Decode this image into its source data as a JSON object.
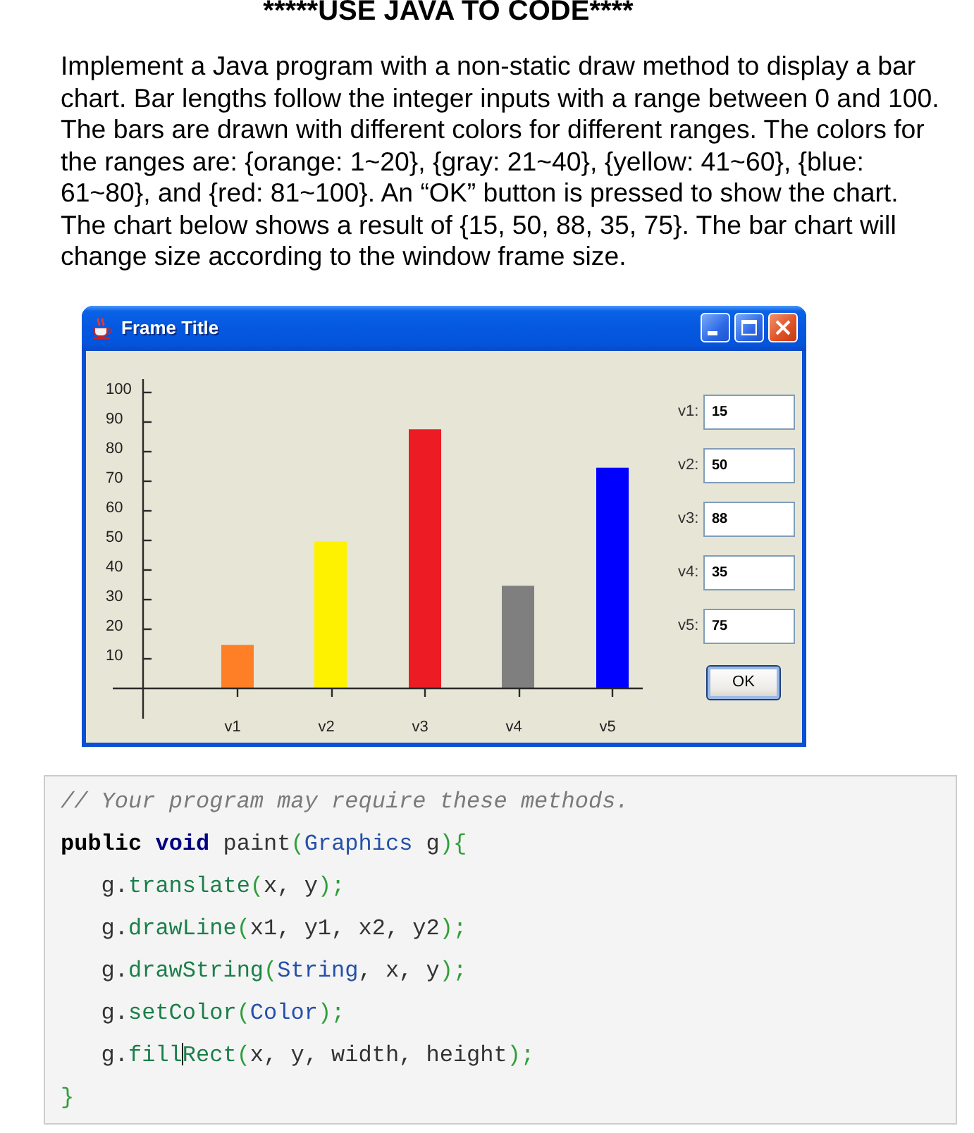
{
  "heading": "*****USE JAVA TO CODE****",
  "paragraph": "Implement a Java program with a non-static draw method to display a bar chart. Bar lengths follow the integer inputs with a range between 0 and 100. The bars are drawn with different colors for different ranges. The colors for the ranges are: {orange: 1~20}, {gray: 21~40}, {yellow: 41~60}, {blue: 61~80}, and {red: 81~100}. An “OK” button is pressed to show the chart. The chart below shows a result of {15, 50, 88, 35, 75}. The bar chart will change size according to the window frame size.",
  "window": {
    "title": "Frame Title",
    "chart": {
      "chart_data": {
        "type": "bar",
        "categories": [
          "v1",
          "v2",
          "v3",
          "v4",
          "v5"
        ],
        "values": [
          15,
          50,
          88,
          35,
          75
        ],
        "colors": [
          "#ff7f27",
          "#fff200",
          "#ed1c24",
          "#7f7f7f",
          "#0000ff"
        ],
        "ylim": [
          -10,
          105
        ],
        "yticks": [
          10,
          20,
          30,
          40,
          50,
          60,
          70,
          80,
          90,
          100
        ]
      }
    },
    "inputs": [
      {
        "label": "v1:",
        "value": "15"
      },
      {
        "label": "v2:",
        "value": "50"
      },
      {
        "label": "v3:",
        "value": "88"
      },
      {
        "label": "v4:",
        "value": "35"
      },
      {
        "label": "v5:",
        "value": "75"
      }
    ],
    "button": "OK"
  },
  "code_block": {
    "lines": [
      {
        "tokens": [
          {
            "kind": "comment",
            "text": "// Your program may require these methods."
          }
        ]
      },
      {
        "tokens": [
          {
            "kind": "modifier",
            "text": "public "
          },
          {
            "kind": "keyword",
            "text": "void "
          },
          {
            "kind": "plain",
            "text": "paint"
          },
          {
            "kind": "punct",
            "text": "("
          },
          {
            "kind": "type",
            "text": "Graphics"
          },
          {
            "kind": "plain",
            "text": " g"
          },
          {
            "kind": "punct",
            "text": "){"
          }
        ],
        "children": [
          {
            "tokens": [
              {
                "kind": "plain",
                "text": "g."
              },
              {
                "kind": "method",
                "text": "translate"
              },
              {
                "kind": "punct",
                "text": "("
              },
              {
                "kind": "plain",
                "text": "x, y"
              },
              {
                "kind": "punct",
                "text": ");"
              }
            ]
          },
          {
            "tokens": [
              {
                "kind": "plain",
                "text": "g."
              },
              {
                "kind": "method",
                "text": "drawLine"
              },
              {
                "kind": "punct",
                "text": "("
              },
              {
                "kind": "plain",
                "text": "x1, y1, x2, y2"
              },
              {
                "kind": "punct",
                "text": ");"
              }
            ]
          },
          {
            "tokens": [
              {
                "kind": "plain",
                "text": "g."
              },
              {
                "kind": "method",
                "text": "drawString"
              },
              {
                "kind": "punct",
                "text": "("
              },
              {
                "kind": "type",
                "text": "String"
              },
              {
                "kind": "plain",
                "text": ", x, y"
              },
              {
                "kind": "punct",
                "text": ");"
              }
            ]
          },
          {
            "tokens": [
              {
                "kind": "plain",
                "text": "g."
              },
              {
                "kind": "method",
                "text": "setColor"
              },
              {
                "kind": "punct",
                "text": "("
              },
              {
                "kind": "type",
                "text": "Color"
              },
              {
                "kind": "punct",
                "text": ");"
              }
            ]
          },
          {
            "tokens": [
              {
                "kind": "plain",
                "text": "g."
              },
              {
                "kind": "method",
                "text": "fill"
              },
              {
                "kind": "caret"
              },
              {
                "kind": "method",
                "text": "Rect"
              },
              {
                "kind": "punct",
                "text": "("
              },
              {
                "kind": "plain",
                "text": "x, y, width, height"
              },
              {
                "kind": "punct",
                "text": ");"
              }
            ]
          }
        ]
      },
      {
        "tokens": [
          {
            "kind": "punct",
            "text": "}"
          }
        ]
      }
    ]
  }
}
